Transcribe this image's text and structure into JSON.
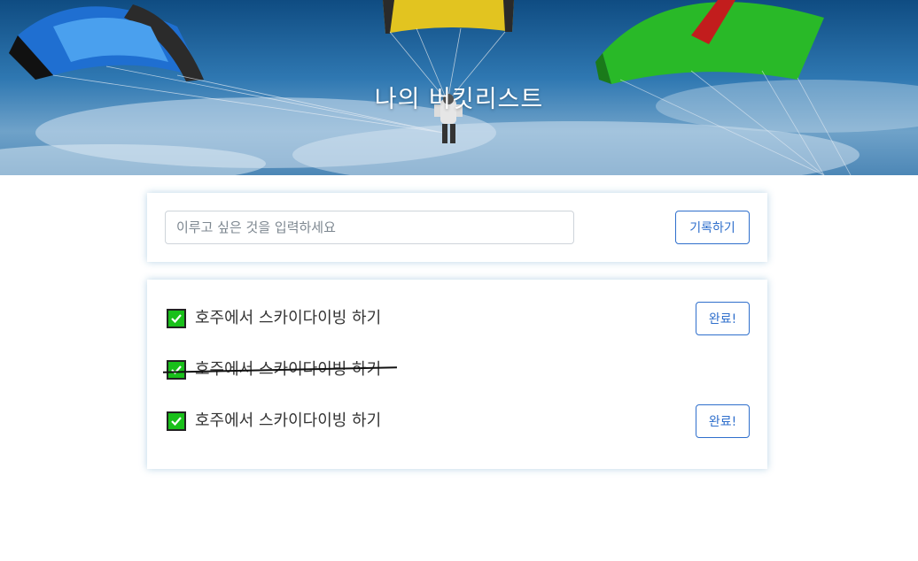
{
  "header": {
    "title": "나의 버킷리스트"
  },
  "form": {
    "placeholder": "이루고 싶은 것을 입력하세요",
    "value": "",
    "submit_label": "기록하기"
  },
  "items": [
    {
      "text": "호주에서 스카이다이빙 하기",
      "checked": true,
      "done": false,
      "button_label": "완료!"
    },
    {
      "text": "호주에서 스카이다이빙 하기",
      "checked": true,
      "done": true
    },
    {
      "text": "호주에서 스카이다이빙 하기",
      "checked": true,
      "done": false,
      "button_label": "완료!"
    }
  ],
  "colors": {
    "accent": "#2f6fcc",
    "checkbox_fill": "#19c01a",
    "sky": "#2f78b2"
  },
  "icons": {
    "checkbox": "check-icon"
  }
}
